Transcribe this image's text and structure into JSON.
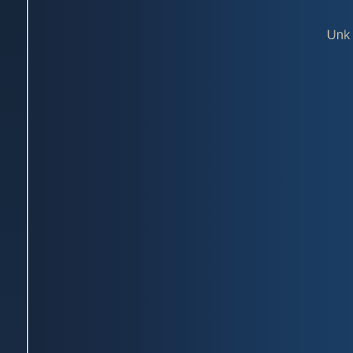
{
  "header": {
    "status_text": "Unk"
  },
  "colors": {
    "background_left": "#17263a",
    "background_right": "#1a3d64",
    "divider": "#cfd3d8",
    "text": "#b9b7a9"
  }
}
